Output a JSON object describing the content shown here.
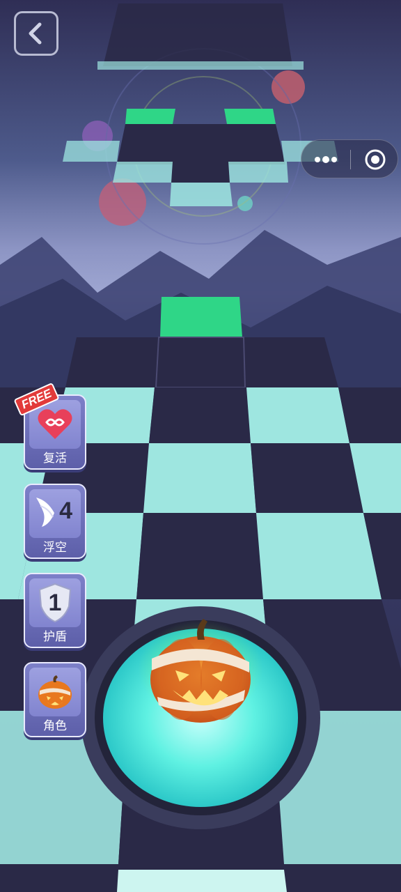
{
  "colors": {
    "dark_tile": "#2a2947",
    "light_tile": "#9ee6e0",
    "target_tile": "#2fd687",
    "platform_glow": "#5ff1e2"
  },
  "top_bar": {
    "back_icon": "chevron-left-icon",
    "capsule_more_icon": "more-dots-icon",
    "capsule_close_icon": "target-circle-icon"
  },
  "side_menu": {
    "revive": {
      "badge": "FREE",
      "icon": "infinity-heart-icon",
      "label": "复活"
    },
    "float": {
      "count": "4",
      "icon": "wing-icon",
      "label": "浮空"
    },
    "shield": {
      "count": "1",
      "icon": "shield-icon",
      "label": "护盾"
    },
    "character": {
      "icon": "pumpkin-icon",
      "label": "角色"
    }
  },
  "player": {
    "icon": "mummy-pumpkin-icon"
  }
}
